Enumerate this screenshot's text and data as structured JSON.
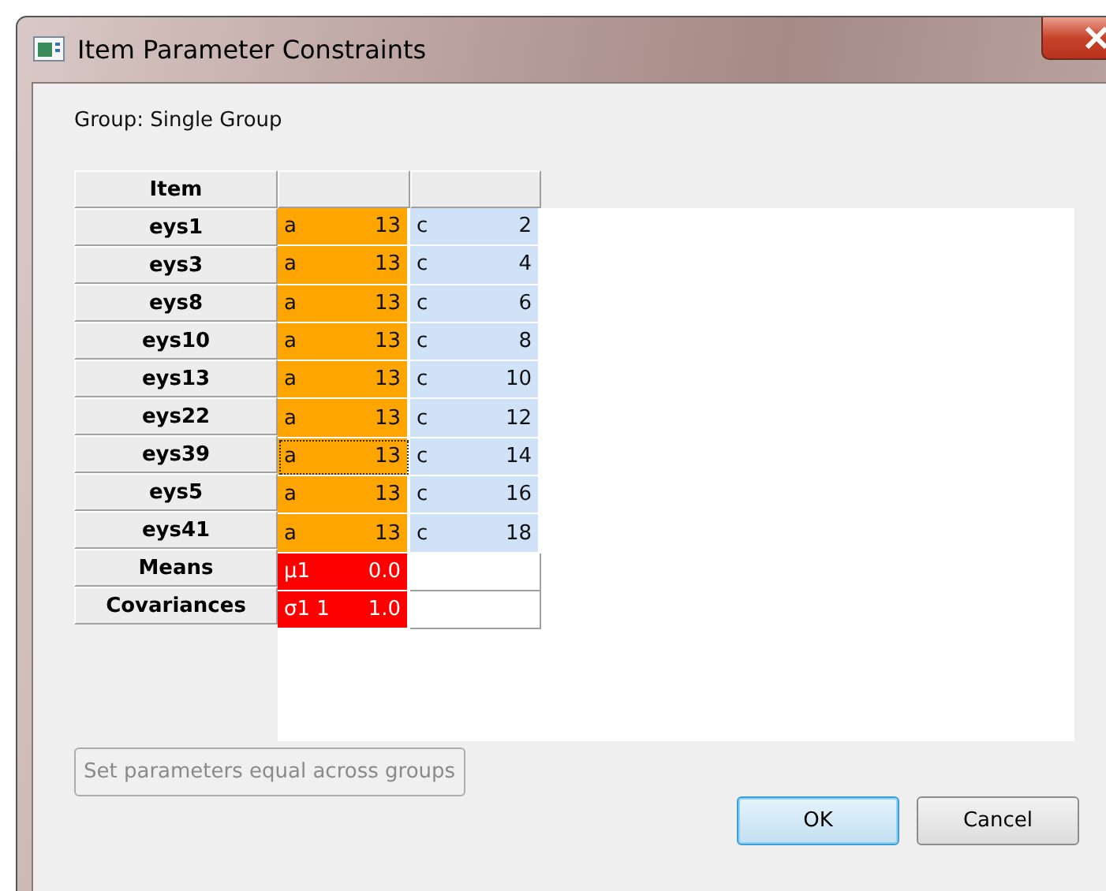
{
  "window": {
    "title": "Item Parameter Constraints"
  },
  "group_label": "Group: Single Group",
  "table": {
    "header": "Item",
    "rows": [
      {
        "item": "eys1",
        "cells": [
          {
            "label": "a",
            "value": "13",
            "color": "#ffa500",
            "focused": false
          },
          {
            "label": "c",
            "value": "2",
            "color": "#cfe2f8",
            "focused": false
          }
        ]
      },
      {
        "item": "eys3",
        "cells": [
          {
            "label": "a",
            "value": "13",
            "color": "#ffa500",
            "focused": false
          },
          {
            "label": "c",
            "value": "4",
            "color": "#cfe2f8",
            "focused": false
          }
        ]
      },
      {
        "item": "eys8",
        "cells": [
          {
            "label": "a",
            "value": "13",
            "color": "#ffa500",
            "focused": false
          },
          {
            "label": "c",
            "value": "6",
            "color": "#cfe2f8",
            "focused": false
          }
        ]
      },
      {
        "item": "eys10",
        "cells": [
          {
            "label": "a",
            "value": "13",
            "color": "#ffa500",
            "focused": false
          },
          {
            "label": "c",
            "value": "8",
            "color": "#cfe2f8",
            "focused": false
          }
        ]
      },
      {
        "item": "eys13",
        "cells": [
          {
            "label": "a",
            "value": "13",
            "color": "#ffa500",
            "focused": false
          },
          {
            "label": "c",
            "value": "10",
            "color": "#cfe2f8",
            "focused": false
          }
        ]
      },
      {
        "item": "eys22",
        "cells": [
          {
            "label": "a",
            "value": "13",
            "color": "#ffa500",
            "focused": false
          },
          {
            "label": "c",
            "value": "12",
            "color": "#cfe2f8",
            "focused": false
          }
        ]
      },
      {
        "item": "eys39",
        "cells": [
          {
            "label": "a",
            "value": "13",
            "color": "#ffa500",
            "focused": true
          },
          {
            "label": "c",
            "value": "14",
            "color": "#cfe2f8",
            "focused": false
          }
        ]
      },
      {
        "item": "eys5",
        "cells": [
          {
            "label": "a",
            "value": "13",
            "color": "#ffa500",
            "focused": false
          },
          {
            "label": "c",
            "value": "16",
            "color": "#cfe2f8",
            "focused": false
          }
        ]
      },
      {
        "item": "eys41",
        "cells": [
          {
            "label": "a",
            "value": "13",
            "color": "#ffa500",
            "focused": false
          },
          {
            "label": "c",
            "value": "18",
            "color": "#cfe2f8",
            "focused": false
          }
        ]
      },
      {
        "item": "Means",
        "cells": [
          {
            "label": "µ1",
            "value": "0.0",
            "color": "#ff0000",
            "focused": false
          }
        ]
      },
      {
        "item": "Covariances",
        "cells": [
          {
            "label": "σ1 1",
            "value": "1.0",
            "color": "#ff0000",
            "focused": false
          }
        ]
      }
    ]
  },
  "equal_button": {
    "label": "Set parameters equal across groups",
    "disabled": true
  },
  "buttons": [
    {
      "label": "OK",
      "default": true
    },
    {
      "label": "Cancel",
      "default": false
    }
  ]
}
